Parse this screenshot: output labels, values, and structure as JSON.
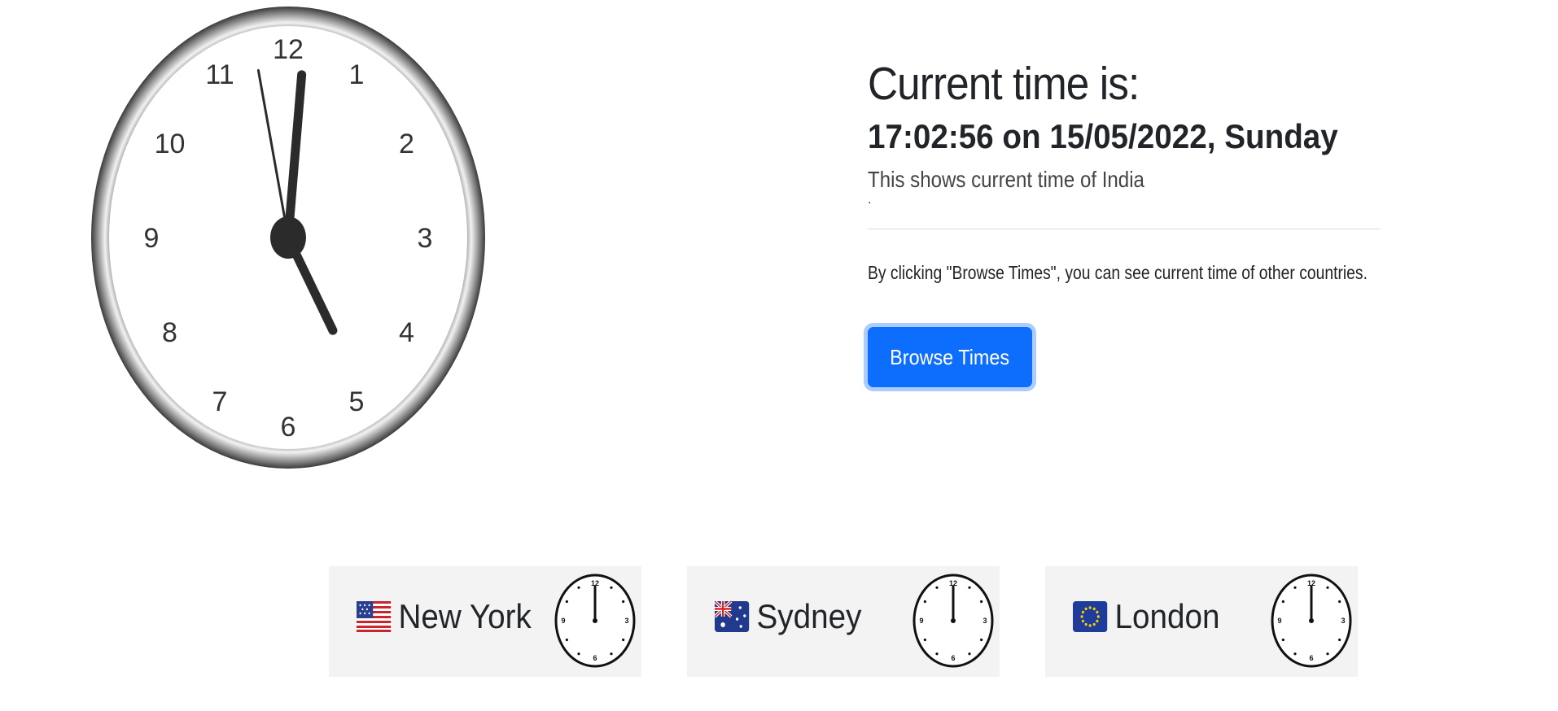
{
  "main_clock": {
    "numerals": [
      "12",
      "1",
      "2",
      "3",
      "4",
      "5",
      "6",
      "7",
      "8",
      "9",
      "10",
      "11"
    ],
    "time": {
      "hour": 17,
      "minute": 2,
      "second": 56
    }
  },
  "info": {
    "heading": "Current time is:",
    "time_line": "17:02:56 on 15/05/2022, Sunday",
    "lead_text": "This shows current time of India",
    "lead_suffix": ".",
    "flag_icon": "india-flag-icon",
    "note": "By clicking \"Browse Times\", you can see current time of other countries.",
    "button_label": "Browse Times",
    "button_color": "#0d6efd"
  },
  "cities": [
    {
      "name": "New York",
      "flag_icon": "us-flag-icon"
    },
    {
      "name": "Sydney",
      "flag_icon": "australia-flag-icon"
    },
    {
      "name": "London",
      "flag_icon": "eu-flag-icon"
    }
  ],
  "mini_clock_numerals": [
    "12",
    "3",
    "6",
    "9"
  ]
}
